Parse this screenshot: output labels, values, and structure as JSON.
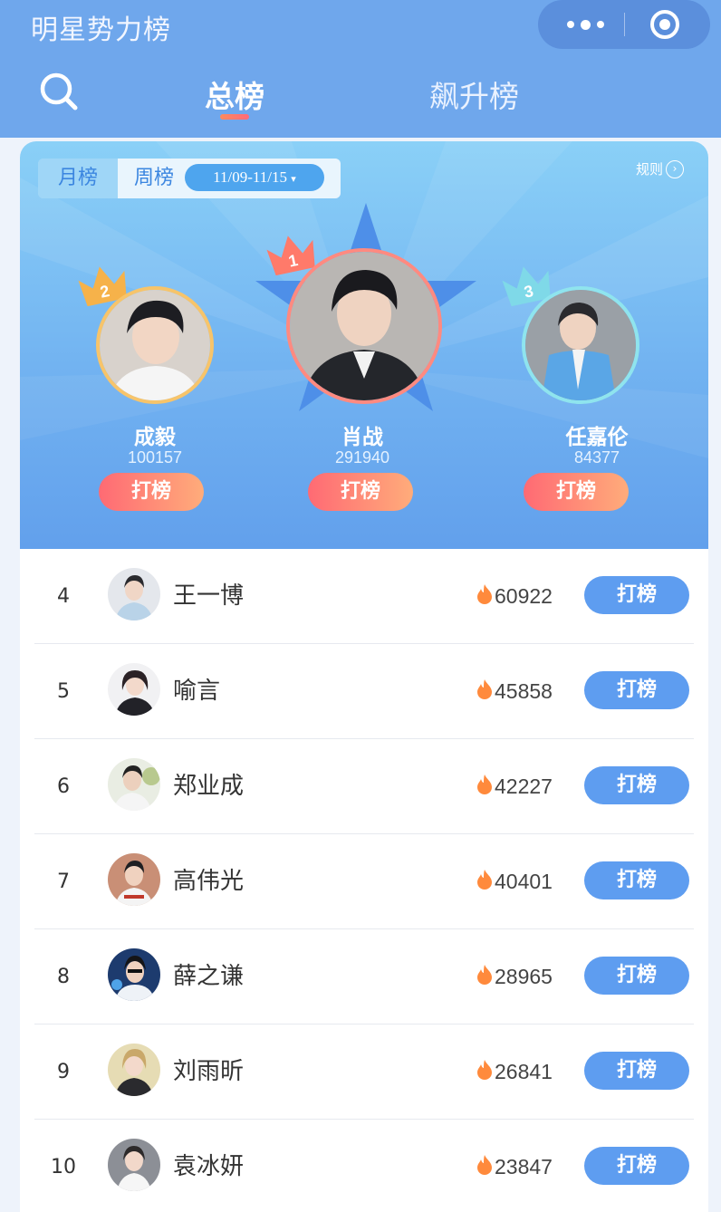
{
  "header": {
    "app_title": "明星势力榜",
    "tabs": [
      {
        "label": "总榜",
        "active": true
      },
      {
        "label": "飙升榜",
        "active": false
      }
    ]
  },
  "filter": {
    "month_label": "月榜",
    "week_label": "周榜",
    "date_range": "11/09-11/15",
    "rules_label": "规则"
  },
  "podium": [
    {
      "rank": "2",
      "name": "成毅",
      "score": "100157",
      "button": "打榜"
    },
    {
      "rank": "1",
      "name": "肖战",
      "score": "291940",
      "button": "打榜"
    },
    {
      "rank": "3",
      "name": "任嘉伦",
      "score": "84377",
      "button": "打榜"
    }
  ],
  "list": [
    {
      "rank": "4",
      "name": "王一博",
      "score": "60922",
      "button": "打榜"
    },
    {
      "rank": "5",
      "name": "喻言",
      "score": "45858",
      "button": "打榜"
    },
    {
      "rank": "6",
      "name": "郑业成",
      "score": "42227",
      "button": "打榜"
    },
    {
      "rank": "7",
      "name": "高伟光",
      "score": "40401",
      "button": "打榜"
    },
    {
      "rank": "8",
      "name": "薛之谦",
      "score": "28965",
      "button": "打榜"
    },
    {
      "rank": "9",
      "name": "刘雨昕",
      "score": "26841",
      "button": "打榜"
    },
    {
      "rank": "10",
      "name": "袁冰妍",
      "score": "23847",
      "button": "打榜"
    }
  ],
  "colors": {
    "header_bg": "#6fa7ec",
    "accent_blue": "#5e9df0",
    "podium_button_start": "#ff6a74",
    "podium_button_end": "#ffac7a",
    "fire": "#ff8a3c"
  }
}
